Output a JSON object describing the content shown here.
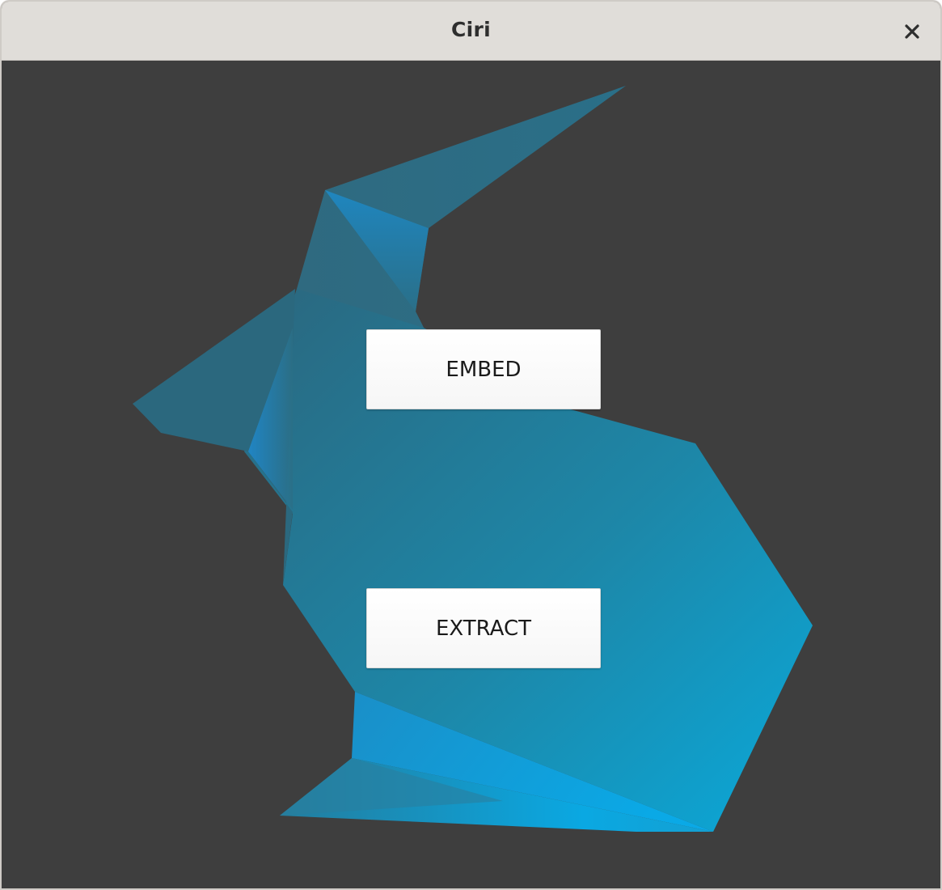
{
  "window": {
    "title": "Ciri"
  },
  "titlebar": {
    "close_icon": "close-icon"
  },
  "main": {
    "illustration_icon": "low-poly-rabbit-icon",
    "buttons": {
      "embed_label": "EMBED",
      "extract_label": "EXTRACT"
    }
  },
  "colors": {
    "background": "#3e3e3e",
    "titlebar": "#e0ddd9",
    "accent_dark": "#2a6c82",
    "accent_light": "#0aa8e0",
    "button_background": "#ffffff"
  }
}
